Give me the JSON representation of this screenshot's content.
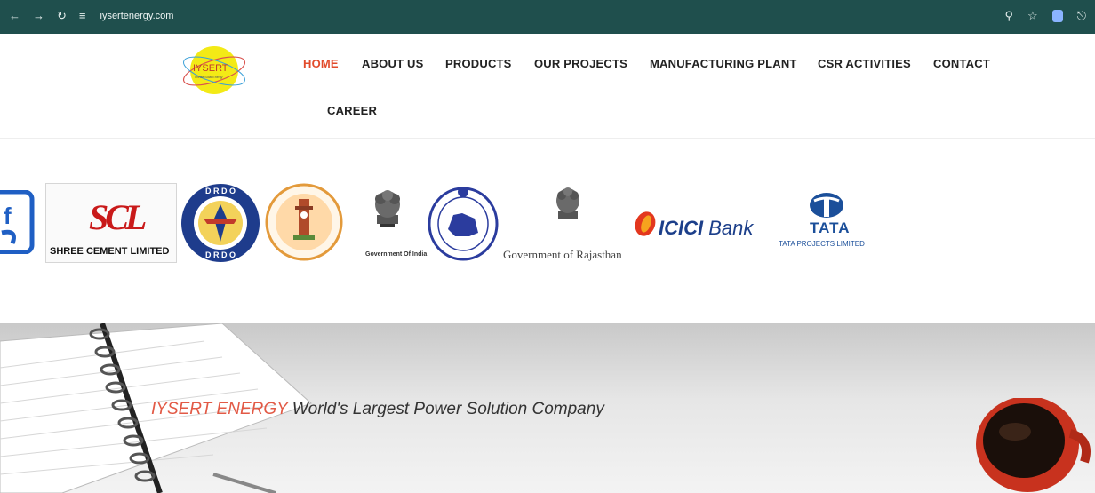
{
  "browser": {
    "url": "iysertenergy.com",
    "back_icon": "arrow-left-icon",
    "forward_icon": "arrow-right-icon",
    "reload_icon": "reload-icon"
  },
  "header": {
    "logo_text": "IYSERT",
    "nav": [
      {
        "label": "HOME",
        "active": true
      },
      {
        "label": "ABOUT US",
        "active": false
      },
      {
        "label": "PRODUCTS",
        "active": false
      },
      {
        "label": "OUR PROJECTS",
        "active": false
      },
      {
        "label": "MANUFACTURING PLANT",
        "active": false
      },
      {
        "label": "CSR ACTIVITIES",
        "active": false
      },
      {
        "label": "CONTACT",
        "active": false
      },
      {
        "label": "CAREER",
        "active": false
      }
    ]
  },
  "clients": {
    "shree_cement": "SHREE CEMENT LIMITED",
    "shree_mark": "SCL",
    "drdo": "D R D O",
    "gov_india": "Government Of India",
    "gov_rajasthan": "Government of Rajasthan",
    "icici": "ICICI",
    "icici_bank": "Bank",
    "tata": "TATA",
    "tata_projects": "TATA PROJECTS LIMITED"
  },
  "hero": {
    "brand": "IYSERT ENERGY",
    "tagline": "World's Largest Power Solution Company"
  },
  "colors": {
    "browser_bar": "#1f4f4d",
    "nav_active": "#e24b2b",
    "hero_brand": "#e25a46"
  }
}
